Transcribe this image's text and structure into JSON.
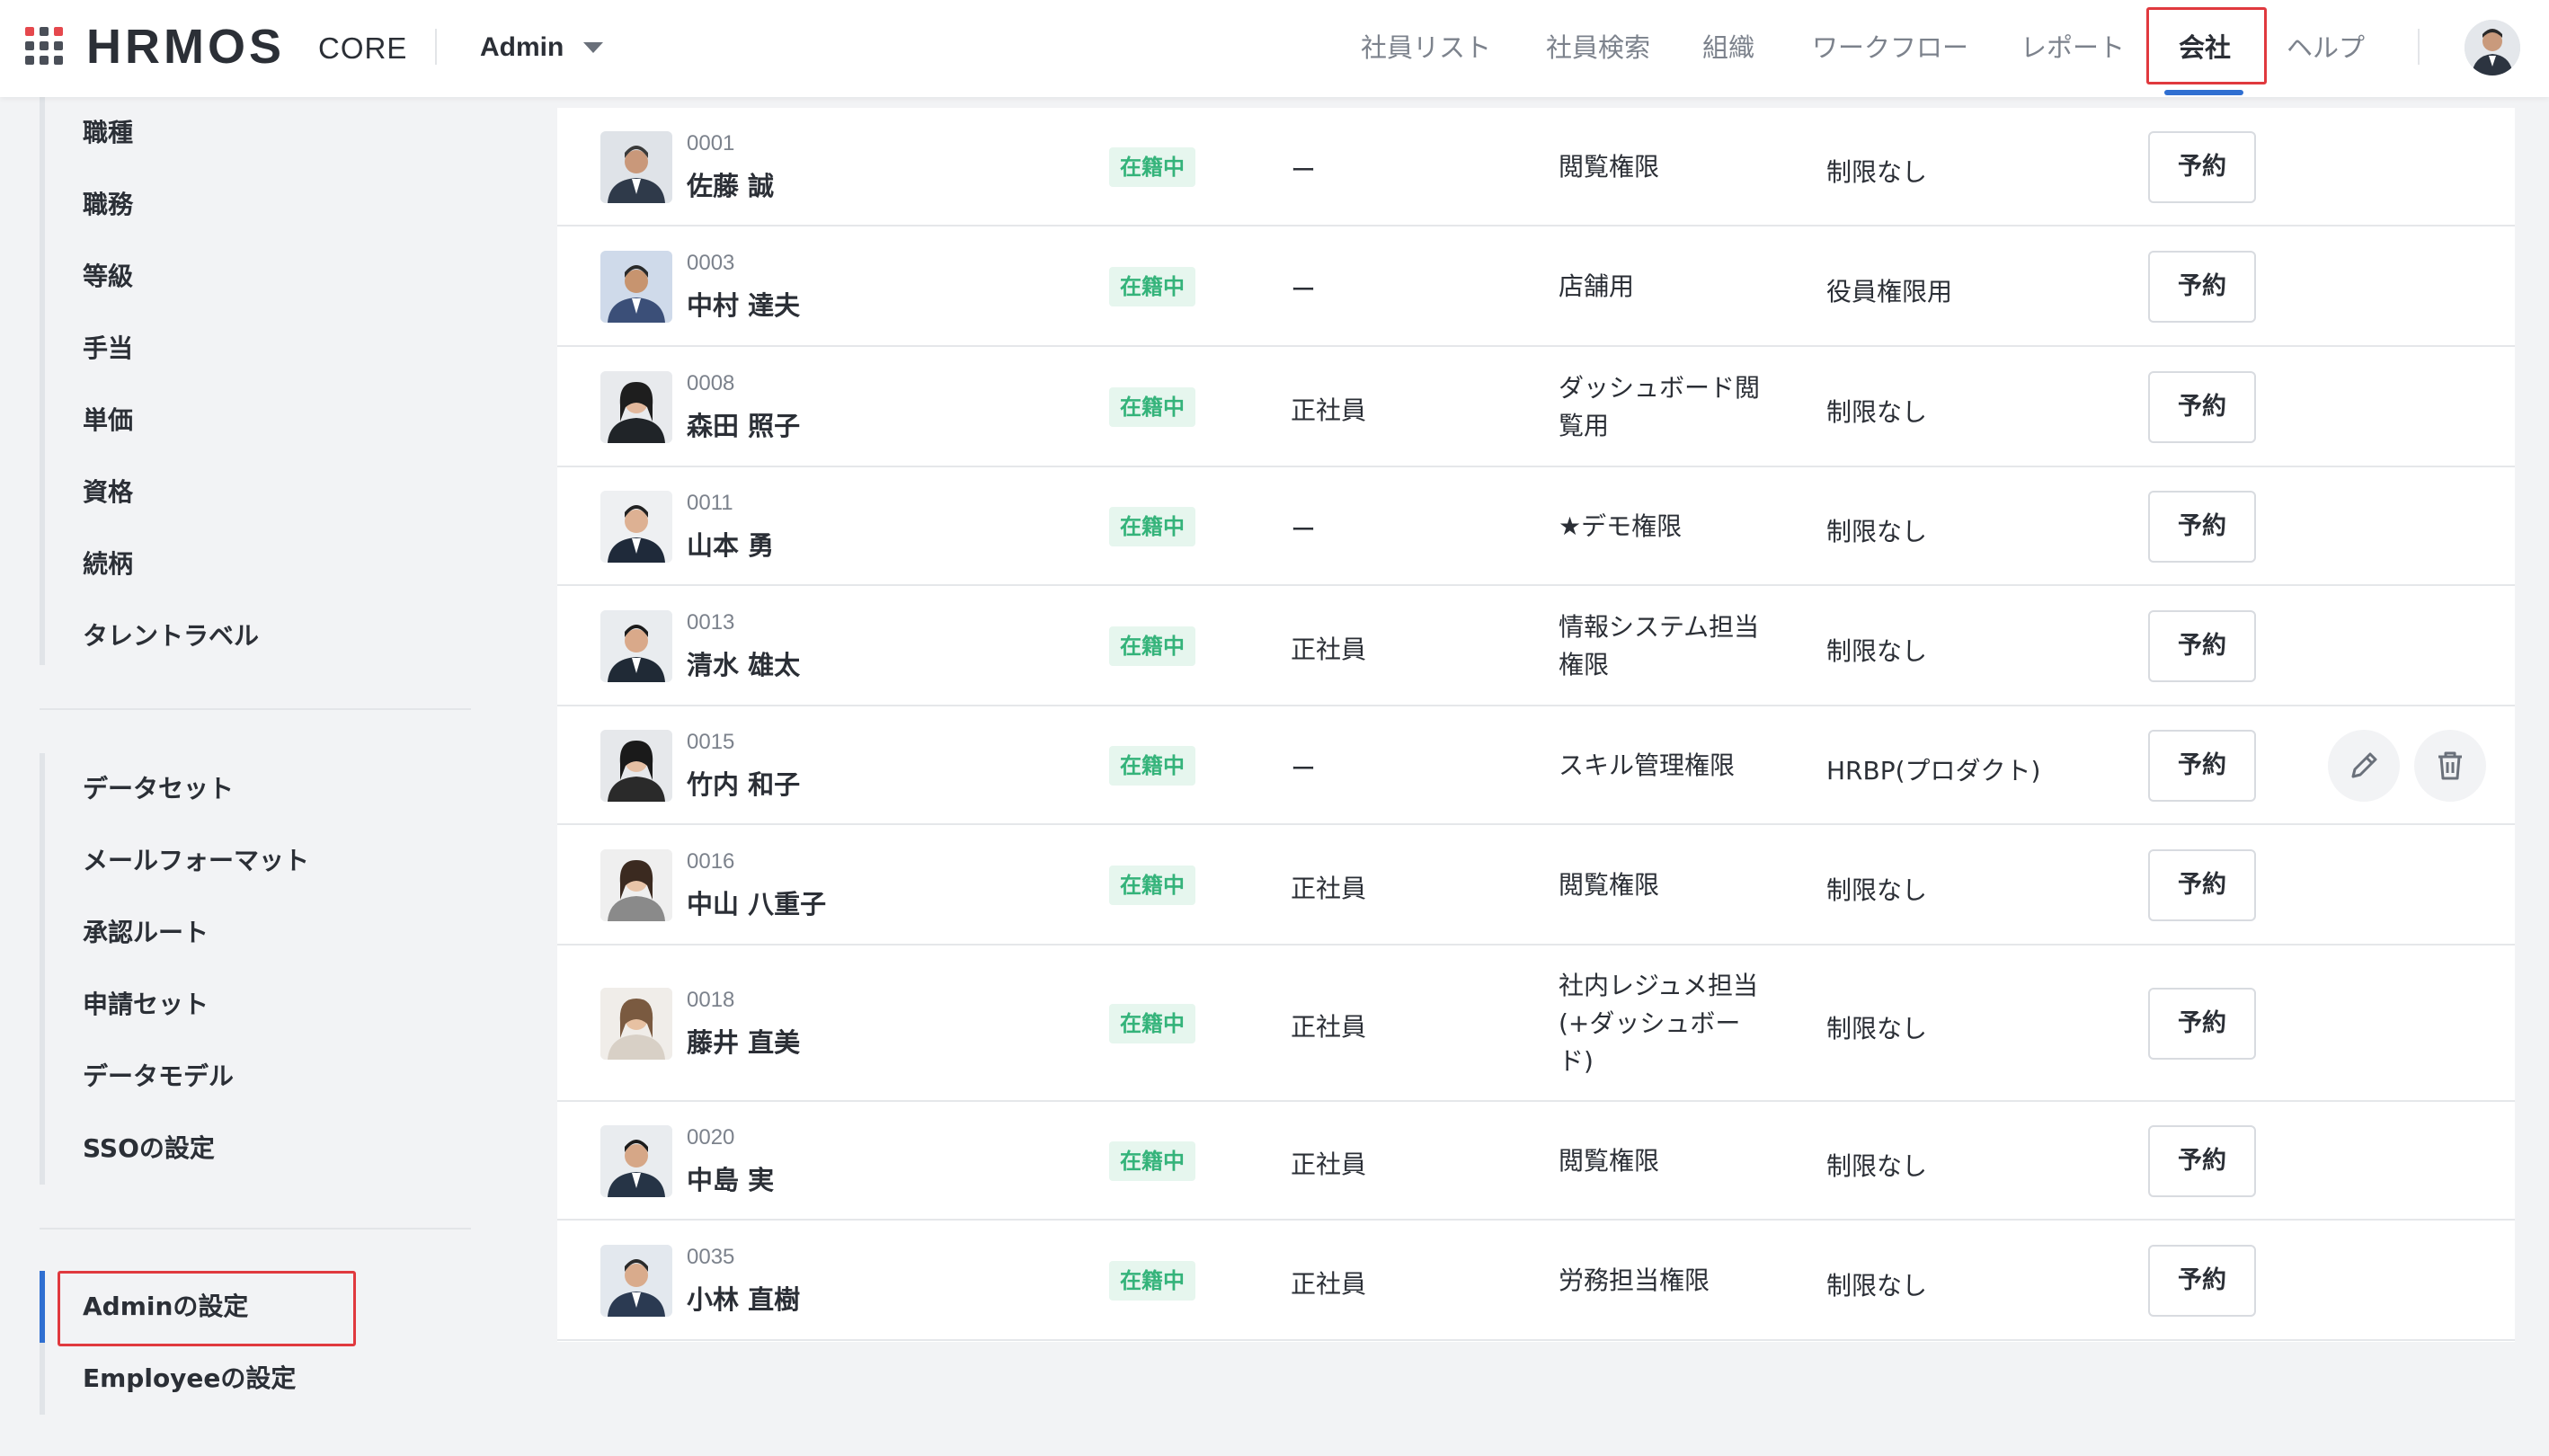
{
  "header": {
    "logo": "HRMOS",
    "logo_sub": "CORE",
    "tenant": "Admin",
    "nav": [
      {
        "label": "社員リスト"
      },
      {
        "label": "社員検索"
      },
      {
        "label": "組織"
      },
      {
        "label": "ワークフロー"
      },
      {
        "label": "レポート"
      },
      {
        "label": "会社",
        "active": true
      },
      {
        "label": "ヘルプ"
      }
    ],
    "icons": {
      "apps": "apps-grid-icon",
      "caret": "chevron-down-icon",
      "avatar": "user-avatar"
    }
  },
  "sidebar": {
    "group1": [
      "職種",
      "職務",
      "等級",
      "手当",
      "単価",
      "資格",
      "続柄",
      "タレントラベル"
    ],
    "group2": [
      "データセット",
      "メールフォーマット",
      "承認ルート",
      "申請セット",
      "データモデル",
      "SSOの設定"
    ],
    "group3": [
      {
        "label": "Adminの設定",
        "selected": true
      },
      {
        "label": "Employeeの設定"
      }
    ]
  },
  "table": {
    "reserve_label": "予約",
    "status_label": "在籍中",
    "rows": [
      {
        "id": "0001",
        "name": "佐藤 誠",
        "type": "ー",
        "perm": "閲覧権限",
        "scope": "制限なし"
      },
      {
        "id": "0003",
        "name": "中村 達夫",
        "type": "ー",
        "perm": "店舗用",
        "scope": "役員権限用"
      },
      {
        "id": "0008",
        "name": "森田 照子",
        "type": "正社員",
        "perm": "ダッシュボード閲覧用",
        "scope": "制限なし"
      },
      {
        "id": "0011",
        "name": "山本 勇",
        "type": "ー",
        "perm": "★デモ権限",
        "scope": "制限なし"
      },
      {
        "id": "0013",
        "name": "清水 雄太",
        "type": "正社員",
        "perm": "情報システム担当権限",
        "scope": "制限なし"
      },
      {
        "id": "0015",
        "name": "竹内 和子",
        "type": "ー",
        "perm": "スキル管理権限",
        "scope": "HRBP(プロダクト)"
      },
      {
        "id": "0016",
        "name": "中山 八重子",
        "type": "正社員",
        "perm": "閲覧権限",
        "scope": "制限なし"
      },
      {
        "id": "0018",
        "name": "藤井 直美",
        "type": "正社員",
        "perm": "社内レジュメ担当(+ダッシュボード)",
        "scope": "制限なし"
      },
      {
        "id": "0020",
        "name": "中島 実",
        "type": "正社員",
        "perm": "閲覧権限",
        "scope": "制限なし"
      },
      {
        "id": "0035",
        "name": "小林 直樹",
        "type": "正社員",
        "perm": "労務担当権限",
        "scope": "制限なし"
      }
    ],
    "row_actions": {
      "edit_icon": "pencil-icon",
      "delete_icon": "trash-icon"
    }
  },
  "colors": {
    "accent": "#2f6fd1",
    "highlight": "#e0393e",
    "status_text": "#34b37a",
    "status_bg": "#e6f6ee"
  }
}
